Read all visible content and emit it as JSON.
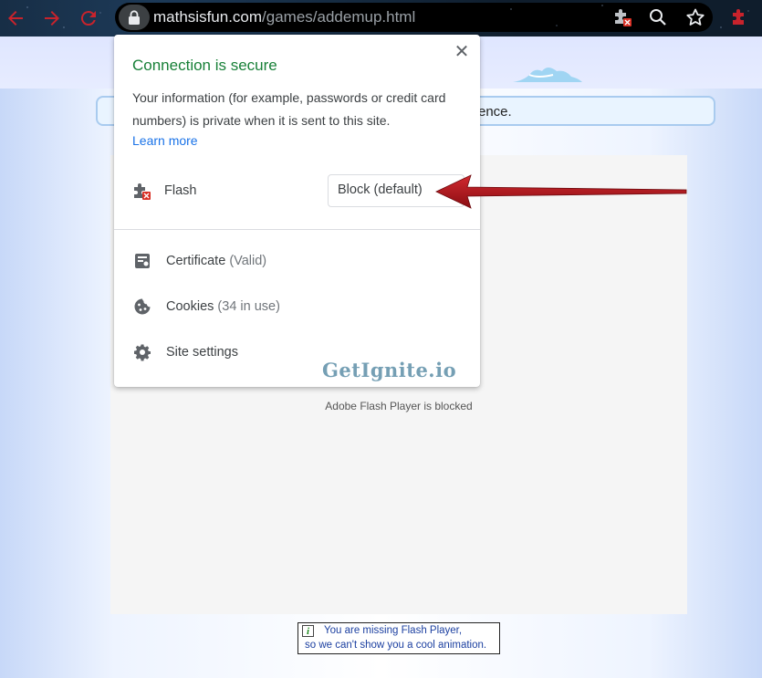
{
  "browser": {
    "url_host": "mathsisfun.com",
    "url_path": "/games/addemup.html",
    "icons": [
      "back-icon",
      "forward-icon",
      "reload-icon",
      "lock-icon",
      "flash-blocked-icon",
      "zoom-icon",
      "star-icon",
      "extension-icon"
    ]
  },
  "page": {
    "notice_text": "rence.",
    "blocked_message": "Adobe Flash Player is blocked",
    "flash_notice": {
      "icon": "i",
      "line1": "You are missing Flash Player,",
      "line2": "so we can't show you a cool animation."
    }
  },
  "popup": {
    "title": "Connection is secure",
    "description": "Your information (for example, passwords or credit card numbers) is private when it is sent to this site.",
    "learn_more": "Learn more",
    "flash_label": "Flash",
    "flash_setting": "Block (default)",
    "certificate_label": "Certificate",
    "certificate_status": "(Valid)",
    "cookies_label": "Cookies",
    "cookies_status": "(34 in use)",
    "site_settings_label": "Site settings"
  },
  "watermark": "GetIgnite.io",
  "colors": {
    "secure_green": "#188038",
    "link_blue": "#1a73e8",
    "arrow_red": "#b0141c",
    "nav_red": "#c8232c"
  }
}
